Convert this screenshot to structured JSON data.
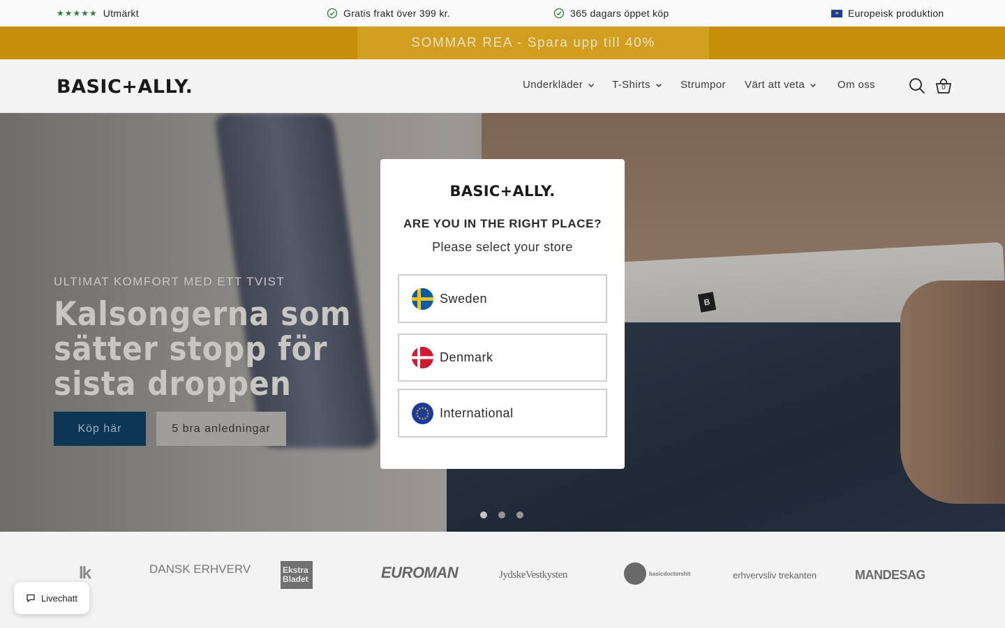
{
  "infobar": {
    "rating_stars": "★★★★★",
    "rating_label": "Utmärkt",
    "shipping": "Gratis frakt över 399 kr.",
    "returns": "365 dagars öppet köp",
    "production": "Europeisk produktion"
  },
  "promo": {
    "text": "SOMMAR REA - Spara upp till 40%"
  },
  "header": {
    "logo": "BASIC+ALLY.",
    "nav": [
      "Underkläder",
      "T-Shirts",
      "Strumpor",
      "Värt att veta",
      "Om oss"
    ],
    "cart_count": "0"
  },
  "hero": {
    "subtitle": "ULTIMAT KOMFORT MED ETT TVIST",
    "title": "Kalsongerna som sätter stopp för sista droppen",
    "primary_button": "Köp här",
    "secondary_button": "5 bra anledningar",
    "slides": 3,
    "active_slide": 1
  },
  "modal": {
    "logo": "BASIC+ALLY.",
    "title": "ARE YOU IN THE RIGHT PLACE?",
    "subtitle": "Please select your store",
    "stores": [
      "Sweden",
      "Denmark",
      "International"
    ]
  },
  "press": {
    "logos": [
      "lk",
      "DANSK ERHVERV",
      "Ekstra Bladet",
      "EUROMAN",
      "JydskeVestkysten",
      "basicdoctorshit",
      "erhvervsliv trekanten",
      "MANDESAG"
    ]
  },
  "livechat": {
    "label": "Livechatt"
  },
  "colors": {
    "promo": "#c78e0b",
    "primary_button": "#0d3654",
    "rating_green": "#2f7a3a"
  }
}
